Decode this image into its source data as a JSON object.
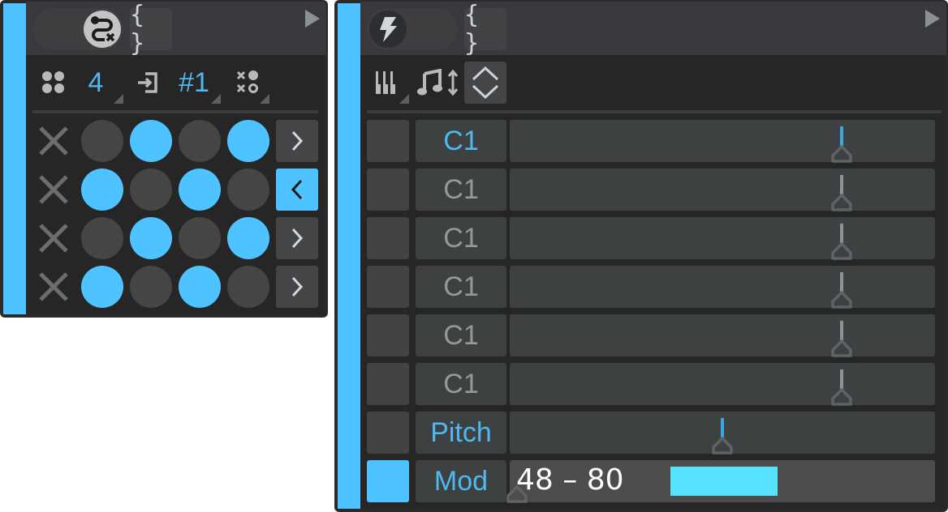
{
  "colors": {
    "accent": "#4fc3ff",
    "accent_text": "#4fb8f0",
    "inactive_text": "#959899",
    "range_bar": "#58e0ff"
  },
  "device1": {
    "toggle_icon": "route-off-icon",
    "brace_label": "{ }",
    "play_icon": "play-icon",
    "toolbar": {
      "steps_icon": "four-dots-icon",
      "steps_value": "4",
      "input_icon": "input-arrow-icon",
      "input_value": "#1",
      "pattern_icon": "xo-pattern-icon"
    },
    "grid": [
      {
        "steps": [
          false,
          true,
          false,
          true
        ],
        "direction": ">",
        "direction_active": false
      },
      {
        "steps": [
          true,
          false,
          true,
          false
        ],
        "direction": "<",
        "direction_active": true
      },
      {
        "steps": [
          false,
          true,
          false,
          true
        ],
        "direction": ">",
        "direction_active": false
      },
      {
        "steps": [
          true,
          false,
          true,
          false
        ],
        "direction": ">",
        "direction_active": false
      }
    ]
  },
  "device2": {
    "toggle_icon": "lightning-icon",
    "brace_label": "{ }",
    "play_icon": "play-icon",
    "toolbar": {
      "piano_icon": "piano-keys-icon",
      "note_icon": "music-note-updown-icon",
      "updown_icon": "chevron-up-down-icon"
    },
    "rows": [
      {
        "label": "C1",
        "active": true,
        "square_on": false,
        "value": 0.78
      },
      {
        "label": "C1",
        "active": false,
        "square_on": false,
        "value": 0.78
      },
      {
        "label": "C1",
        "active": false,
        "square_on": false,
        "value": 0.78
      },
      {
        "label": "C1",
        "active": false,
        "square_on": false,
        "value": 0.78
      },
      {
        "label": "C1",
        "active": false,
        "square_on": false,
        "value": 0.78
      },
      {
        "label": "C1",
        "active": false,
        "square_on": false,
        "value": 0.78
      },
      {
        "label": "Pitch",
        "active": true,
        "square_on": false,
        "value": 0.5
      }
    ],
    "mod_row": {
      "label": "Mod",
      "square_on": true,
      "range_text": "48 – 80",
      "range_start": 48,
      "range_end": 80,
      "range_max": 127
    }
  }
}
